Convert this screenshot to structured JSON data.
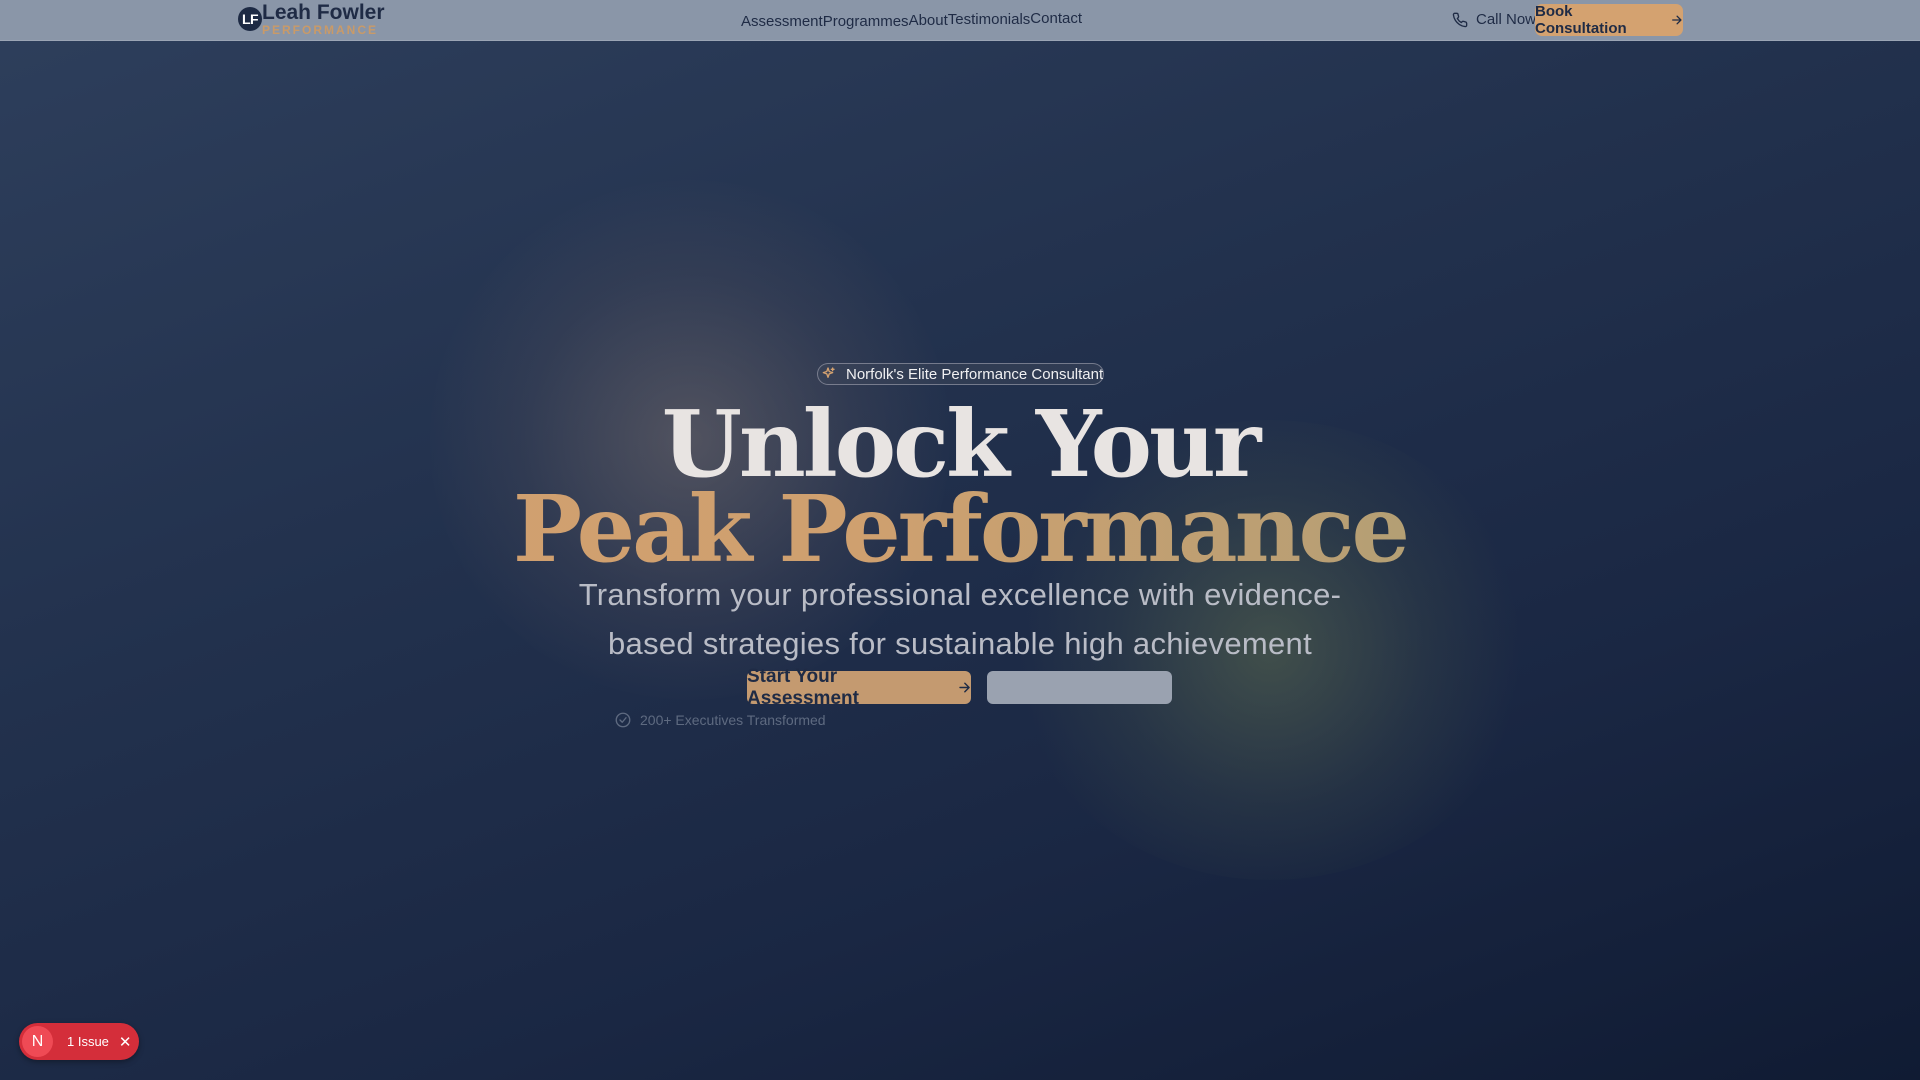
{
  "header": {
    "logo_mark": "LF",
    "logo_name": "Leah Fowler",
    "logo_sub": "PERFORMANCE",
    "nav": [
      "Assessment",
      "Programmes",
      "About",
      "Testimonials",
      "Contact"
    ],
    "call_label": "Call Now",
    "book_label": "Book Consultation"
  },
  "hero": {
    "badge": "Norfolk's Elite Performance Consultant",
    "title_line1": "Unlock Your",
    "title_line2": "Peak Performance",
    "subtitle": "Transform your professional excellence with evidence-based strategies for sustainable high achievement",
    "cta_primary": "Start Your Assessment",
    "trust_1": "200+ Executives Transformed"
  },
  "dev_overlay": {
    "badge_letter": "N",
    "issues_label": "1 Issue"
  },
  "colors": {
    "accent": "#d4a270",
    "navy": "#1f2b45",
    "issue_red": "#d42e3a"
  }
}
